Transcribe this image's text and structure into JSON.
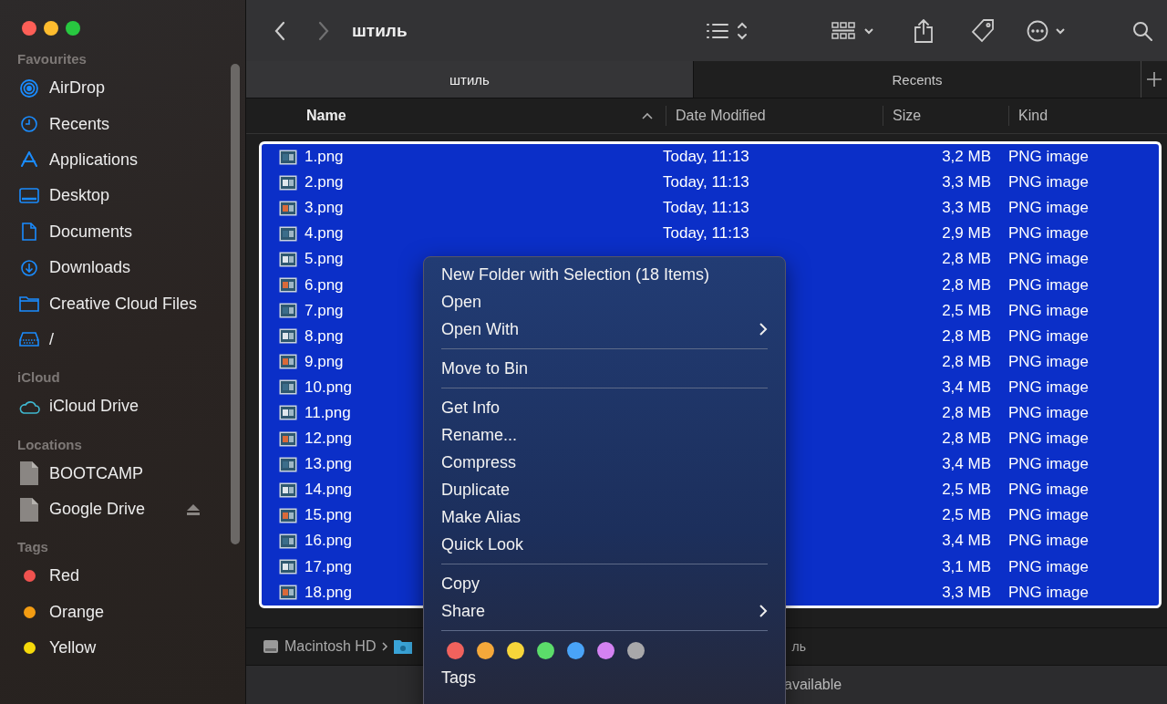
{
  "window": {
    "title": "штиль"
  },
  "sidebar": {
    "sections": [
      {
        "title": "Favourites",
        "items": [
          {
            "label": "AirDrop"
          },
          {
            "label": "Recents"
          },
          {
            "label": "Applications"
          },
          {
            "label": "Desktop"
          },
          {
            "label": "Documents"
          },
          {
            "label": "Downloads"
          },
          {
            "label": "Creative Cloud Files"
          },
          {
            "label": "/"
          }
        ]
      },
      {
        "title": "iCloud",
        "items": [
          {
            "label": "iCloud Drive"
          }
        ]
      },
      {
        "title": "Locations",
        "items": [
          {
            "label": "BOOTCAMP",
            "eject": false
          },
          {
            "label": "Google Drive",
            "eject": true
          }
        ]
      },
      {
        "title": "Tags",
        "items": [
          {
            "label": "Red",
            "color": "#f0524f"
          },
          {
            "label": "Orange",
            "color": "#f39c12"
          },
          {
            "label": "Yellow",
            "color": "#f5d90a"
          }
        ]
      }
    ]
  },
  "tabs": [
    {
      "label": "штиль",
      "selected": true
    },
    {
      "label": "Recents",
      "selected": false
    }
  ],
  "table": {
    "columns": [
      {
        "label": "Name",
        "sorted": true
      },
      {
        "label": "Date Modified",
        "sorted": false
      },
      {
        "label": "Size",
        "sorted": false
      },
      {
        "label": "Kind",
        "sorted": false
      }
    ],
    "rows": [
      {
        "name": "1.png",
        "date": "Today, 11:13",
        "size": "3,2 MB",
        "kind": "PNG image",
        "selected": true
      },
      {
        "name": "2.png",
        "date": "Today, 11:13",
        "size": "3,3 MB",
        "kind": "PNG image",
        "selected": true
      },
      {
        "name": "3.png",
        "date": "Today, 11:13",
        "size": "3,3 MB",
        "kind": "PNG image",
        "selected": true
      },
      {
        "name": "4.png",
        "date": "Today, 11:13",
        "size": "2,9 MB",
        "kind": "PNG image",
        "selected": true
      },
      {
        "name": "5.png",
        "size": "2,8 MB",
        "kind": "PNG image",
        "selected": true
      },
      {
        "name": "6.png",
        "size": "2,8 MB",
        "kind": "PNG image",
        "selected": true
      },
      {
        "name": "7.png",
        "size": "2,5 MB",
        "kind": "PNG image",
        "selected": true
      },
      {
        "name": "8.png",
        "size": "2,8 MB",
        "kind": "PNG image",
        "selected": true
      },
      {
        "name": "9.png",
        "size": "2,8 MB",
        "kind": "PNG image",
        "selected": true
      },
      {
        "name": "10.png",
        "size": "3,4 MB",
        "kind": "PNG image",
        "selected": true
      },
      {
        "name": "11.png",
        "size": "2,8 MB",
        "kind": "PNG image",
        "selected": true
      },
      {
        "name": "12.png",
        "size": "2,8 MB",
        "kind": "PNG image",
        "selected": true
      },
      {
        "name": "13.png",
        "size": "3,4 MB",
        "kind": "PNG image",
        "selected": true
      },
      {
        "name": "14.png",
        "size": "2,5 MB",
        "kind": "PNG image",
        "selected": true
      },
      {
        "name": "15.png",
        "size": "2,5 MB",
        "kind": "PNG image",
        "selected": true
      },
      {
        "name": "16.png",
        "size": "3,4 MB",
        "kind": "PNG image",
        "selected": true
      },
      {
        "name": "17.png",
        "size": "3,1 MB",
        "kind": "PNG image",
        "selected": true
      },
      {
        "name": "18.png",
        "size": "3,3 MB",
        "kind": "PNG image",
        "selected": true
      }
    ]
  },
  "path_bar": {
    "items": [
      "Macintosh HD",
      "ль"
    ]
  },
  "status_bar": {
    "text": "available"
  },
  "context_menu": {
    "items": [
      {
        "kind": "item",
        "label": "New Folder with Selection (18 Items)"
      },
      {
        "kind": "item",
        "label": "Open"
      },
      {
        "kind": "submenu",
        "label": "Open With"
      },
      {
        "kind": "separator"
      },
      {
        "kind": "item",
        "label": "Move to Bin"
      },
      {
        "kind": "separator"
      },
      {
        "kind": "item",
        "label": "Get Info"
      },
      {
        "kind": "item",
        "label": "Rename..."
      },
      {
        "kind": "item",
        "label": "Compress"
      },
      {
        "kind": "item",
        "label": "Duplicate"
      },
      {
        "kind": "item",
        "label": "Make Alias"
      },
      {
        "kind": "item",
        "label": "Quick Look"
      },
      {
        "kind": "separator"
      },
      {
        "kind": "item",
        "label": "Copy"
      },
      {
        "kind": "submenu",
        "label": "Share"
      },
      {
        "kind": "separator"
      },
      {
        "kind": "tags",
        "colors": [
          {
            "color": "#f0625d"
          },
          {
            "color": "#f5a83a"
          },
          {
            "color": "#f7d53a"
          },
          {
            "color": "#5bdc6a"
          },
          {
            "color": "#49a3f8"
          },
          {
            "color": "#d482f2"
          },
          {
            "color": "#a8a8aa"
          }
        ]
      },
      {
        "kind": "item",
        "label": "Tags"
      }
    ]
  }
}
